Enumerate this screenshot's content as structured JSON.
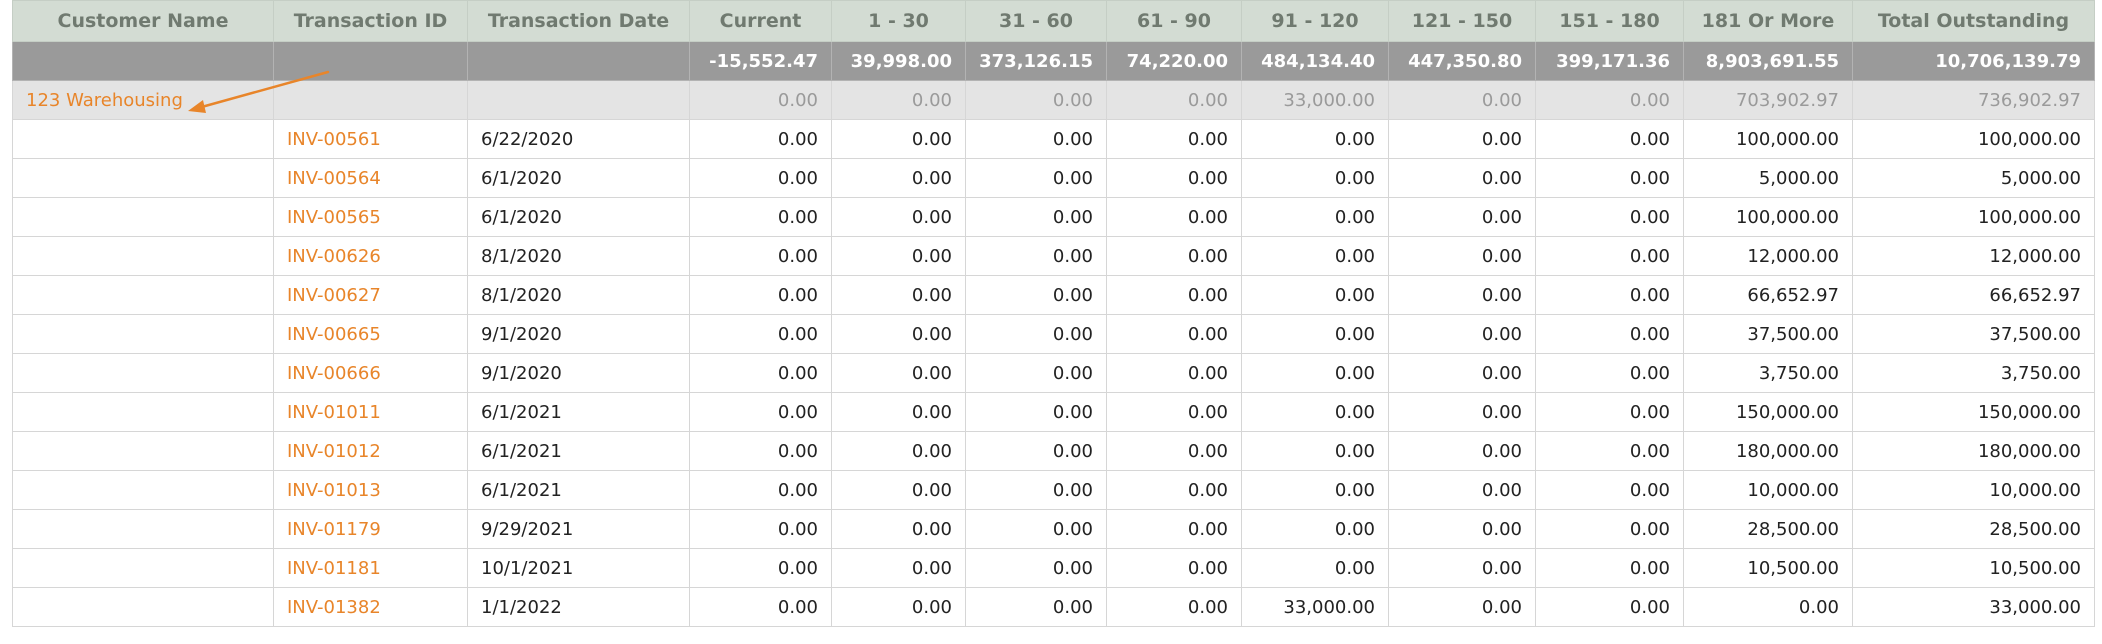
{
  "columns": [
    "Customer Name",
    "Transaction ID",
    "Transaction Date",
    "Current",
    "1 - 30",
    "31 - 60",
    "61 - 90",
    "91 - 120",
    "121 - 150",
    "151 - 180",
    "181 Or More",
    "Total Outstanding"
  ],
  "totals": {
    "current": "-15,552.47",
    "d1_30": "39,998.00",
    "d31_60": "373,126.15",
    "d61_90": "74,220.00",
    "d91_120": "484,134.40",
    "d121_150": "447,350.80",
    "d151_180": "399,171.36",
    "d181_more": "8,903,691.55",
    "total": "10,706,139.79"
  },
  "group": {
    "customer": "123 Warehousing",
    "current": "0.00",
    "d1_30": "0.00",
    "d31_60": "0.00",
    "d61_90": "0.00",
    "d91_120": "33,000.00",
    "d121_150": "0.00",
    "d151_180": "0.00",
    "d181_more": "703,902.97",
    "total": "736,902.97"
  },
  "rows": [
    {
      "id": "INV-00561",
      "date": "6/22/2020",
      "current": "0.00",
      "d1_30": "0.00",
      "d31_60": "0.00",
      "d61_90": "0.00",
      "d91_120": "0.00",
      "d121_150": "0.00",
      "d151_180": "0.00",
      "d181_more": "100,000.00",
      "total": "100,000.00"
    },
    {
      "id": "INV-00564",
      "date": "6/1/2020",
      "current": "0.00",
      "d1_30": "0.00",
      "d31_60": "0.00",
      "d61_90": "0.00",
      "d91_120": "0.00",
      "d121_150": "0.00",
      "d151_180": "0.00",
      "d181_more": "5,000.00",
      "total": "5,000.00"
    },
    {
      "id": "INV-00565",
      "date": "6/1/2020",
      "current": "0.00",
      "d1_30": "0.00",
      "d31_60": "0.00",
      "d61_90": "0.00",
      "d91_120": "0.00",
      "d121_150": "0.00",
      "d151_180": "0.00",
      "d181_more": "100,000.00",
      "total": "100,000.00"
    },
    {
      "id": "INV-00626",
      "date": "8/1/2020",
      "current": "0.00",
      "d1_30": "0.00",
      "d31_60": "0.00",
      "d61_90": "0.00",
      "d91_120": "0.00",
      "d121_150": "0.00",
      "d151_180": "0.00",
      "d181_more": "12,000.00",
      "total": "12,000.00"
    },
    {
      "id": "INV-00627",
      "date": "8/1/2020",
      "current": "0.00",
      "d1_30": "0.00",
      "d31_60": "0.00",
      "d61_90": "0.00",
      "d91_120": "0.00",
      "d121_150": "0.00",
      "d151_180": "0.00",
      "d181_more": "66,652.97",
      "total": "66,652.97"
    },
    {
      "id": "INV-00665",
      "date": "9/1/2020",
      "current": "0.00",
      "d1_30": "0.00",
      "d31_60": "0.00",
      "d61_90": "0.00",
      "d91_120": "0.00",
      "d121_150": "0.00",
      "d151_180": "0.00",
      "d181_more": "37,500.00",
      "total": "37,500.00"
    },
    {
      "id": "INV-00666",
      "date": "9/1/2020",
      "current": "0.00",
      "d1_30": "0.00",
      "d31_60": "0.00",
      "d61_90": "0.00",
      "d91_120": "0.00",
      "d121_150": "0.00",
      "d151_180": "0.00",
      "d181_more": "3,750.00",
      "total": "3,750.00"
    },
    {
      "id": "INV-01011",
      "date": "6/1/2021",
      "current": "0.00",
      "d1_30": "0.00",
      "d31_60": "0.00",
      "d61_90": "0.00",
      "d91_120": "0.00",
      "d121_150": "0.00",
      "d151_180": "0.00",
      "d181_more": "150,000.00",
      "total": "150,000.00"
    },
    {
      "id": "INV-01012",
      "date": "6/1/2021",
      "current": "0.00",
      "d1_30": "0.00",
      "d31_60": "0.00",
      "d61_90": "0.00",
      "d91_120": "0.00",
      "d121_150": "0.00",
      "d151_180": "0.00",
      "d181_more": "180,000.00",
      "total": "180,000.00"
    },
    {
      "id": "INV-01013",
      "date": "6/1/2021",
      "current": "0.00",
      "d1_30": "0.00",
      "d31_60": "0.00",
      "d61_90": "0.00",
      "d91_120": "0.00",
      "d121_150": "0.00",
      "d151_180": "0.00",
      "d181_more": "10,000.00",
      "total": "10,000.00"
    },
    {
      "id": "INV-01179",
      "date": "9/29/2021",
      "current": "0.00",
      "d1_30": "0.00",
      "d31_60": "0.00",
      "d61_90": "0.00",
      "d91_120": "0.00",
      "d121_150": "0.00",
      "d151_180": "0.00",
      "d181_more": "28,500.00",
      "total": "28,500.00"
    },
    {
      "id": "INV-01181",
      "date": "10/1/2021",
      "current": "0.00",
      "d1_30": "0.00",
      "d31_60": "0.00",
      "d61_90": "0.00",
      "d91_120": "0.00",
      "d121_150": "0.00",
      "d151_180": "0.00",
      "d181_more": "10,500.00",
      "total": "10,500.00"
    },
    {
      "id": "INV-01382",
      "date": "1/1/2022",
      "current": "0.00",
      "d1_30": "0.00",
      "d31_60": "0.00",
      "d61_90": "0.00",
      "d91_120": "33,000.00",
      "d121_150": "0.00",
      "d151_180": "0.00",
      "d181_more": "0.00",
      "total": "33,000.00"
    }
  ],
  "colors": {
    "link": "#e8852a",
    "header_bg": "#d3dcd3",
    "total_bg": "#9a9a9a",
    "group_bg": "#e4e4e4"
  },
  "annotation": {
    "arrow_icon": "arrow-pointer-icon",
    "arrow_color": "#e8852a"
  }
}
